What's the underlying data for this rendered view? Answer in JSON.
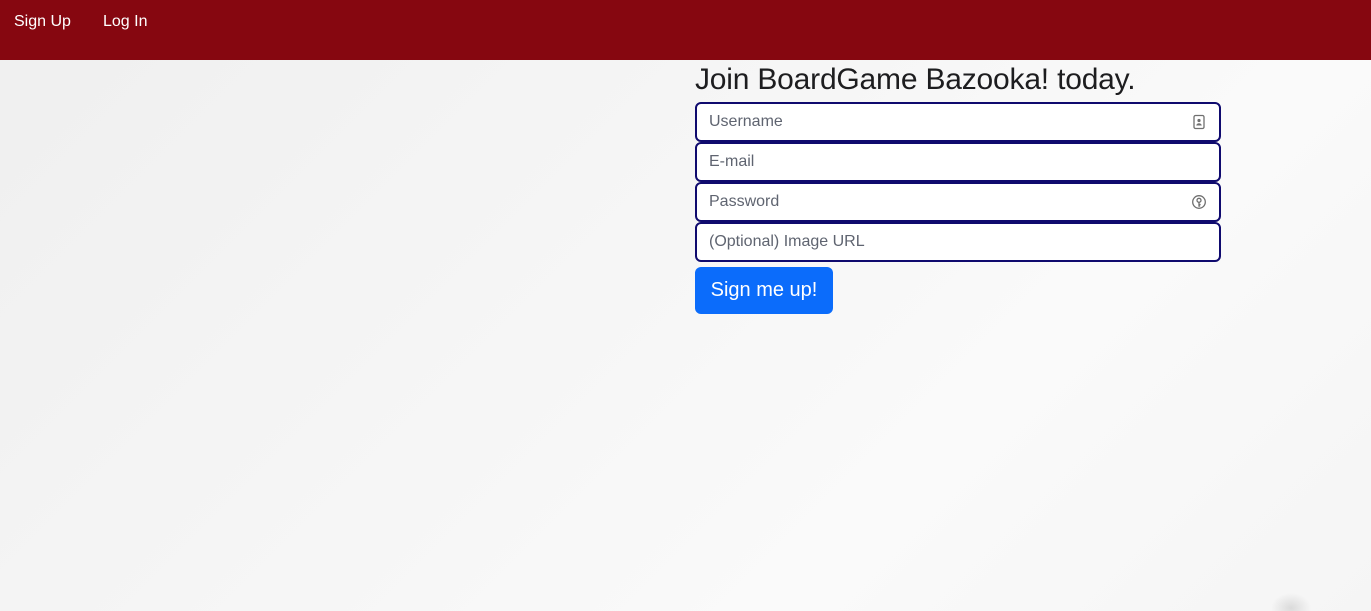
{
  "nav": {
    "signup_label": "Sign Up",
    "login_label": "Log In"
  },
  "colors": {
    "navbar": "#860710",
    "field_border": "#0f0a6e",
    "primary_button": "#0b6cfb"
  },
  "form": {
    "heading": "Join BoardGame Bazooka! today.",
    "username": {
      "placeholder": "Username",
      "value": "",
      "icon": "contact-card-icon"
    },
    "email": {
      "placeholder": "E-mail",
      "value": ""
    },
    "password": {
      "placeholder": "Password",
      "value": "",
      "icon": "password-key-icon"
    },
    "image_url": {
      "placeholder": "(Optional) Image URL",
      "value": ""
    },
    "submit_label": "Sign me up!"
  }
}
